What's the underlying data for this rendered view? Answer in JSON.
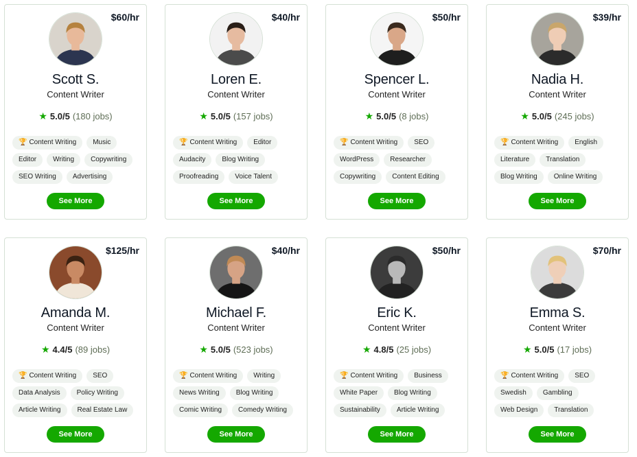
{
  "colors": {
    "accent": "#14a800",
    "tag_bg": "#eff3ef",
    "border": "#d5e0d5"
  },
  "cards": [
    {
      "rate": "$60/hr",
      "name": "Scott S.",
      "title": "Content Writer",
      "score": "5.0/5",
      "jobs": "(180 jobs)",
      "tags": [
        [
          "Content Writing",
          "Music"
        ],
        [
          "Editor",
          "Writing",
          "Copywriting"
        ],
        [
          "SEO Writing",
          "Advertising"
        ]
      ],
      "button": "See More",
      "avatar_icon": "profile-photo",
      "avatar": {
        "bg": "#d9d4cc",
        "skin": "#e8b99a",
        "hair": "#b5823f",
        "shirt": "#2c3550"
      }
    },
    {
      "rate": "$40/hr",
      "name": "Loren E.",
      "title": "Content Writer",
      "score": "5.0/5",
      "jobs": "(157 jobs)",
      "tags": [
        [
          "Content Writing",
          "Editor"
        ],
        [
          "Audacity",
          "Blog Writing"
        ],
        [
          "Proofreading",
          "Voice Talent"
        ]
      ],
      "button": "See More",
      "avatar_icon": "profile-photo",
      "avatar": {
        "bg": "#f2f2f2",
        "skin": "#e6bba0",
        "hair": "#2a1f18",
        "shirt": "#4b4b4b"
      }
    },
    {
      "rate": "$50/hr",
      "name": "Spencer L.",
      "title": "Content Writer",
      "score": "5.0/5",
      "jobs": "(8 jobs)",
      "tags": [
        [
          "Content Writing",
          "SEO"
        ],
        [
          "WordPress",
          "Researcher"
        ],
        [
          "Copywriting",
          "Content Editing"
        ]
      ],
      "button": "See More",
      "avatar_icon": "profile-photo",
      "avatar": {
        "bg": "#f5f5f5",
        "skin": "#d9a788",
        "hair": "#3a2a1e",
        "shirt": "#1e1e1e"
      }
    },
    {
      "rate": "$39/hr",
      "name": "Nadia H.",
      "title": "Content Writer",
      "score": "5.0/5",
      "jobs": "(245 jobs)",
      "tags": [
        [
          "Content Writing",
          "English"
        ],
        [
          "Literature",
          "Translation"
        ],
        [
          "Blog Writing",
          "Online Writing"
        ]
      ],
      "button": "See More",
      "avatar_icon": "profile-photo",
      "avatar": {
        "bg": "#a7a49c",
        "skin": "#efcdb5",
        "hair": "#c9a66b",
        "shirt": "#2b2b2b"
      }
    },
    {
      "rate": "$125/hr",
      "name": "Amanda M.",
      "title": "Content Writer",
      "score": "4.4/5",
      "jobs": "(89 jobs)",
      "tags": [
        [
          "Content Writing",
          "SEO"
        ],
        [
          "Data Analysis",
          "Policy Writing"
        ],
        [
          "Article Writing",
          "Real Estate Law"
        ]
      ],
      "button": "See More",
      "avatar_icon": "profile-photo",
      "avatar": {
        "bg": "#8a4a2c",
        "skin": "#c98a64",
        "hair": "#3b2212",
        "shirt": "#f0e6d8"
      }
    },
    {
      "rate": "$40/hr",
      "name": "Michael F.",
      "title": "Content Writer",
      "score": "5.0/5",
      "jobs": "(523 jobs)",
      "tags": [
        [
          "Content Writing",
          "Writing"
        ],
        [
          "News Writing",
          "Blog Writing"
        ],
        [
          "Comic Writing",
          "Comedy Writing"
        ]
      ],
      "button": "See More",
      "avatar_icon": "profile-photo",
      "avatar": {
        "bg": "#6e6e6e",
        "skin": "#d6a385",
        "hair": "#c08a55",
        "shirt": "#151515"
      }
    },
    {
      "rate": "$50/hr",
      "name": "Eric K.",
      "title": "Content Writer",
      "score": "4.8/5",
      "jobs": "(25 jobs)",
      "tags": [
        [
          "Content Writing",
          "Business"
        ],
        [
          "White Paper",
          "Blog Writing"
        ],
        [
          "Sustainability",
          "Article Writing"
        ]
      ],
      "button": "See More",
      "avatar_icon": "profile-photo",
      "avatar": {
        "bg": "#3c3c3c",
        "skin": "#b9b9b9",
        "hair": "#2b2b2b",
        "shirt": "#222222"
      }
    },
    {
      "rate": "$70/hr",
      "name": "Emma S.",
      "title": "Content Writer",
      "score": "5.0/5",
      "jobs": "(17 jobs)",
      "tags": [
        [
          "Content Writing",
          "SEO"
        ],
        [
          "Swedish",
          "Gambling"
        ],
        [
          "Web Design",
          "Translation"
        ]
      ],
      "button": "See More",
      "avatar_icon": "profile-photo",
      "avatar": {
        "bg": "#dcdcdc",
        "skin": "#efcfb8",
        "hair": "#e2c27a",
        "shirt": "#3b3b3b"
      }
    }
  ]
}
